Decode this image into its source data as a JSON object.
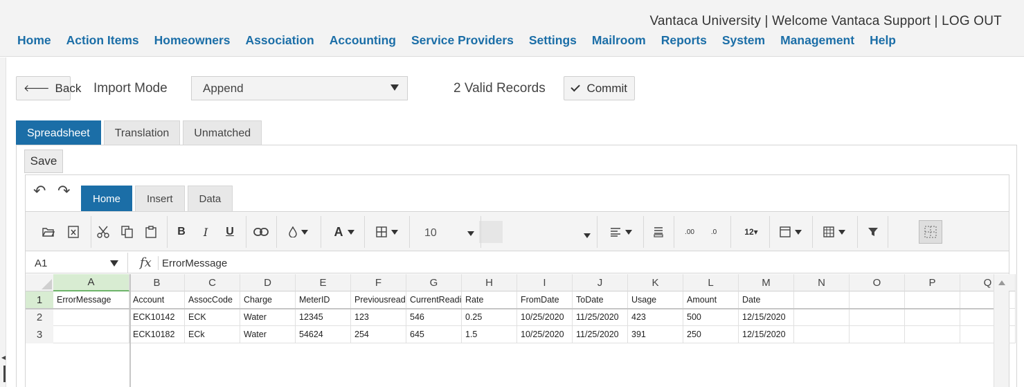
{
  "header": {
    "org": "Vantaca University",
    "sep1": " | ",
    "welcome": "Welcome Vantaca Support",
    "sep2": " | ",
    "logout": "LOG OUT",
    "nav": [
      "Home",
      "Action Items",
      "Homeowners",
      "Association",
      "Accounting",
      "Service Providers",
      "Settings",
      "Mailroom",
      "Reports",
      "System",
      "Management",
      "Help"
    ]
  },
  "toolbar": {
    "back_label": "Back",
    "import_mode_label": "Import Mode",
    "import_mode_value": "Append",
    "valid_records": "2 Valid Records",
    "commit_label": "Commit"
  },
  "tabs": [
    "Spreadsheet",
    "Translation",
    "Unmatched"
  ],
  "sheet": {
    "save_label": "Save",
    "ribbon_tabs": [
      "Home",
      "Insert",
      "Data"
    ],
    "font_size": "10",
    "cell_ref": "A1",
    "formula_value": "ErrorMessage",
    "fx_label": "fx",
    "number_format_label": "12"
  },
  "grid": {
    "columns": [
      "A",
      "B",
      "C",
      "D",
      "E",
      "F",
      "G",
      "H",
      "I",
      "J",
      "K",
      "L",
      "M",
      "N",
      "O",
      "P",
      "Q"
    ],
    "row_numbers": [
      "1",
      "2",
      "3"
    ],
    "rows": [
      [
        "ErrorMessage",
        "Account",
        "AssocCode",
        "Charge",
        "MeterID",
        "Previousreadi",
        "CurrentReadir",
        "Rate",
        "FromDate",
        "ToDate",
        "Usage",
        "Amount",
        "Date",
        "",
        "",
        "",
        ""
      ],
      [
        "",
        "ECK10142",
        "ECK",
        "Water",
        "12345",
        "123",
        "546",
        "0.25",
        "10/25/2020",
        "11/25/2020",
        "423",
        "500",
        "12/15/2020",
        "",
        "",
        "",
        ""
      ],
      [
        "",
        "ECK10182",
        "ECk",
        "Water",
        "54624",
        "254",
        "645",
        "1.5",
        "10/25/2020",
        "11/25/2020",
        "391",
        "250",
        "12/15/2020",
        "",
        "",
        "",
        ""
      ]
    ]
  },
  "colors": {
    "accent": "#1b6ea7",
    "selected_header": "#d8ecd2"
  }
}
